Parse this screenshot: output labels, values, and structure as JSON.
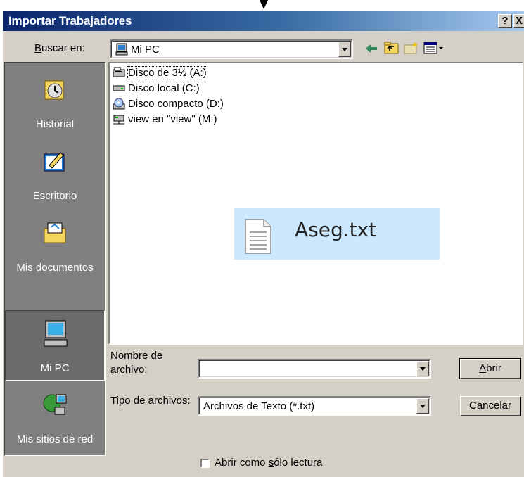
{
  "window": {
    "title": "Importar Trabajadores",
    "help_label": "?",
    "close_label": "X"
  },
  "look_in": {
    "label": "Buscar en:",
    "underline": "B",
    "value": "Mi PC"
  },
  "places": [
    {
      "label": "Historial",
      "icon": "history-icon"
    },
    {
      "label": "Escritorio",
      "icon": "desktop-icon"
    },
    {
      "label": "Mis documentos",
      "icon": "my-documents-icon"
    },
    {
      "label": "Mi PC",
      "icon": "my-computer-icon",
      "selected": true
    },
    {
      "label": "Mis sitios de red",
      "icon": "network-places-icon"
    }
  ],
  "files": [
    {
      "name": "Disco de 3½ (A:)",
      "icon": "floppy-drive-icon",
      "focused": true
    },
    {
      "name": "Disco local (C:)",
      "icon": "hard-drive-icon"
    },
    {
      "name": "Disco compacto (D:)",
      "icon": "cd-drive-icon"
    },
    {
      "name": "view en \"view\" (M:)",
      "icon": "network-drive-icon"
    }
  ],
  "overlay": {
    "filename": "Aseg.txt",
    "icon": "text-file-icon"
  },
  "filename_field": {
    "label_line1": "Nombre de",
    "label_line2": "archivo:",
    "value": ""
  },
  "filetype_field": {
    "label": "Tipo de archivos:",
    "value": "Archivos de Texto (*.txt)"
  },
  "buttons": {
    "open": "Abrir",
    "cancel": "Cancelar"
  },
  "readonly_checkbox": {
    "label": "Abrir como sólo lectura",
    "checked": false
  },
  "colors": {
    "titlebar_start": "#0a246a",
    "titlebar_end": "#a6caf0",
    "dialog_bg": "#d4d0c8",
    "highlight": "#cce8ff"
  }
}
